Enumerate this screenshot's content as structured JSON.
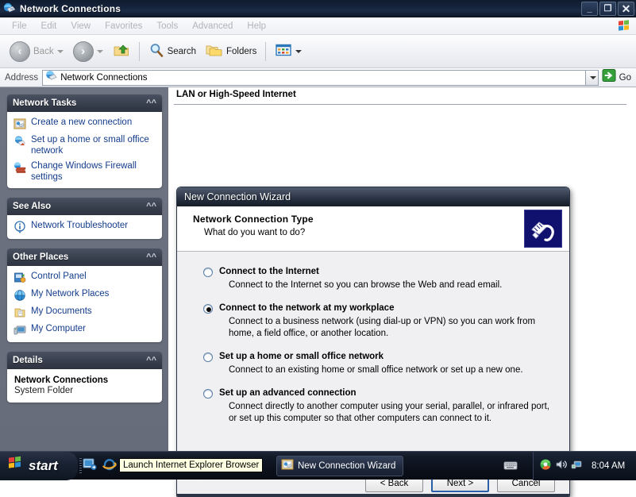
{
  "window": {
    "title": "Network Connections",
    "icon": "network-connections-icon",
    "controls": {
      "minimize": "_",
      "restore": "❐",
      "close": "✕"
    }
  },
  "menubar": {
    "items": [
      {
        "label": "File"
      },
      {
        "label": "Edit"
      },
      {
        "label": "View"
      },
      {
        "label": "Favorites"
      },
      {
        "label": "Tools"
      },
      {
        "label": "Advanced"
      },
      {
        "label": "Help"
      }
    ]
  },
  "toolbar": {
    "back_label": "Back",
    "search_label": "Search",
    "folders_label": "Folders"
  },
  "address": {
    "label": "Address",
    "value": "Network Connections",
    "go_label": "Go"
  },
  "content": {
    "header": "LAN or High-Speed Internet"
  },
  "sidebar": {
    "panels": [
      {
        "title": "Network Tasks",
        "items": [
          {
            "label": "Create a new connection",
            "icon": "new-connection-icon"
          },
          {
            "label": "Set up a home or small office network",
            "icon": "home-network-icon"
          },
          {
            "label": "Change Windows Firewall settings",
            "icon": "firewall-icon"
          }
        ]
      },
      {
        "title": "See Also",
        "items": [
          {
            "label": "Network Troubleshooter",
            "icon": "info-icon"
          }
        ]
      },
      {
        "title": "Other Places",
        "items": [
          {
            "label": "Control Panel",
            "icon": "control-panel-icon"
          },
          {
            "label": "My Network Places",
            "icon": "network-places-icon"
          },
          {
            "label": "My Documents",
            "icon": "documents-icon"
          },
          {
            "label": "My Computer",
            "icon": "computer-icon"
          }
        ]
      },
      {
        "title": "Details",
        "detail_title": "Network Connections",
        "detail_sub": "System Folder"
      }
    ]
  },
  "wizard": {
    "title": "New Connection Wizard",
    "banner_heading": "Network Connection Type",
    "banner_sub": "What do you want to do?",
    "banner_icon": "network-plug-icon",
    "options": [
      {
        "title": "Connect to the Internet",
        "desc": "Connect to the Internet so you can browse the Web and read email.",
        "selected": false
      },
      {
        "title": "Connect to the network at my workplace",
        "desc": "Connect to a business network (using dial-up or VPN) so you can work from home, a field office, or another location.",
        "selected": true
      },
      {
        "title": "Set up a home or small office network",
        "desc": "Connect to an existing home or small office network or set up a new one.",
        "selected": false
      },
      {
        "title": "Set up an advanced connection",
        "desc": "Connect directly to another computer using your serial, parallel, or infrared port, or set up this computer so that other computers can connect to it.",
        "selected": false
      }
    ],
    "buttons": {
      "back": "< Back",
      "next": "Next >",
      "cancel": "Cancel"
    }
  },
  "taskbar": {
    "start_label": "start",
    "quicklaunch": [
      {
        "icon": "show-desktop-icon"
      },
      {
        "icon": "internet-explorer-icon"
      },
      {
        "icon": "media-player-icon"
      }
    ],
    "tasks": [
      {
        "label": "New Connection Wizard",
        "icon": "new-connection-icon"
      }
    ],
    "tray": {
      "icons": [
        {
          "icon": "network-shield-icon"
        },
        {
          "icon": "volume-icon"
        },
        {
          "icon": "network-activity-icon"
        }
      ],
      "clock": "8:04 AM"
    },
    "keyboard_icon": "keyboard-icon",
    "tooltip": "Launch Internet Explorer Browser"
  },
  "colors": {
    "titlebar_dark": "#16243c",
    "sidebar_bg": "#6a7080",
    "panel_head": "#39404e",
    "link_blue": "#143c8c",
    "default_button_border": "#2b5fa8"
  }
}
